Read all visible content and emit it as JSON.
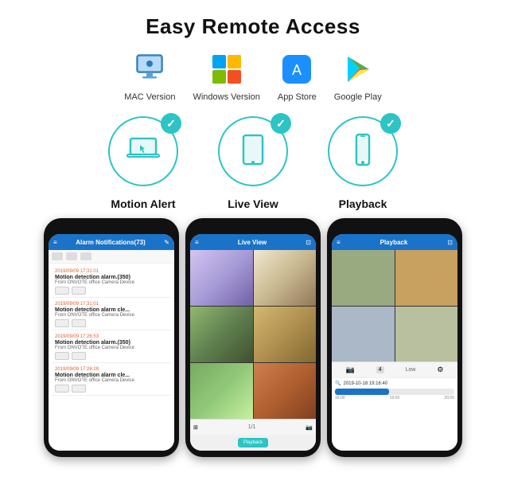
{
  "title": "Easy Remote Access",
  "platforms": [
    {
      "id": "mac",
      "label": "MAC Version"
    },
    {
      "id": "windows",
      "label": "Windows Version"
    },
    {
      "id": "appstore",
      "label": "App Store"
    },
    {
      "id": "googleplay",
      "label": "Google Play"
    }
  ],
  "features": [
    {
      "id": "laptop",
      "label": "Motion Alert"
    },
    {
      "id": "tablet",
      "label": "Live View"
    },
    {
      "id": "phone",
      "label": "Playback"
    }
  ],
  "phones": {
    "motion_alert": {
      "header_title": "Alarm Notifications(73)",
      "entries": [
        {
          "time": "2019/09/09 17:31:01",
          "title": "Motion detection alarm.(350)",
          "from": "From ONVOTE office Camera Device"
        },
        {
          "time": "2019/09/09 17:31:01",
          "title": "Motion detection alarm cle...",
          "from": "From ONVOTE office Camera Device"
        },
        {
          "time": "2019/09/09 17:26:53",
          "title": "Motion detection alarm.(350)",
          "from": "From ONVOTE office Camera Device"
        },
        {
          "time": "2019/09/09 17:26:28",
          "title": "Motion detection alarm cle...",
          "from": "From ONVOTE office Camera Device"
        }
      ]
    },
    "live_view": {
      "header_title": "Live View",
      "footer_label": "1/1",
      "playback_btn": "Playback"
    },
    "playback": {
      "header_title": "Playback",
      "timestamp": "2019-10-18 19:16:40",
      "timeline_start": "18:00",
      "timeline_mid": "19:00",
      "timeline_end": "20:00"
    }
  },
  "checkmark": "✓"
}
